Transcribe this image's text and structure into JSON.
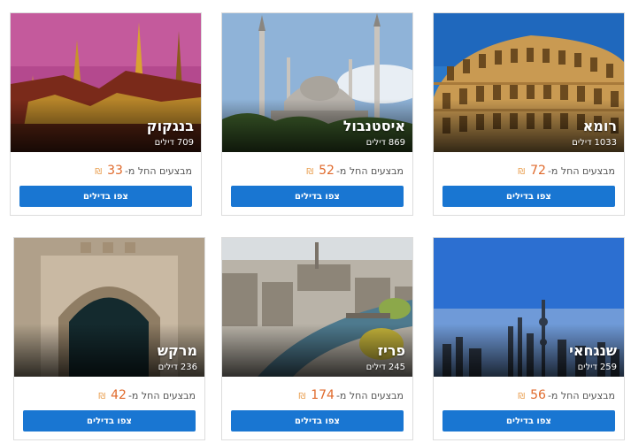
{
  "deals_suffix": "דילים",
  "price_prefix": "מבצעים החל מ-",
  "shekel_icon": "₪",
  "cards": [
    {
      "city": "רומא",
      "deals": "1033",
      "price": "72",
      "button": "צפו בדילים"
    },
    {
      "city": "איסטנבול",
      "deals": "869",
      "price": "52",
      "button": "צפו בדילים"
    },
    {
      "city": "בנגקוק",
      "deals": "709",
      "price": "33",
      "button": "צפו בדילים"
    },
    {
      "city": "שנגחאי",
      "deals": "259",
      "price": "56",
      "button": "צפו בדילים"
    },
    {
      "city": "פריז",
      "deals": "245",
      "price": "174",
      "button": "צפו בדילים"
    },
    {
      "city": "מרקש",
      "deals": "236",
      "price": "42",
      "button": "צפו בדילים"
    }
  ],
  "colors": {
    "button": "#1976d2",
    "price": "#e06a2c"
  }
}
